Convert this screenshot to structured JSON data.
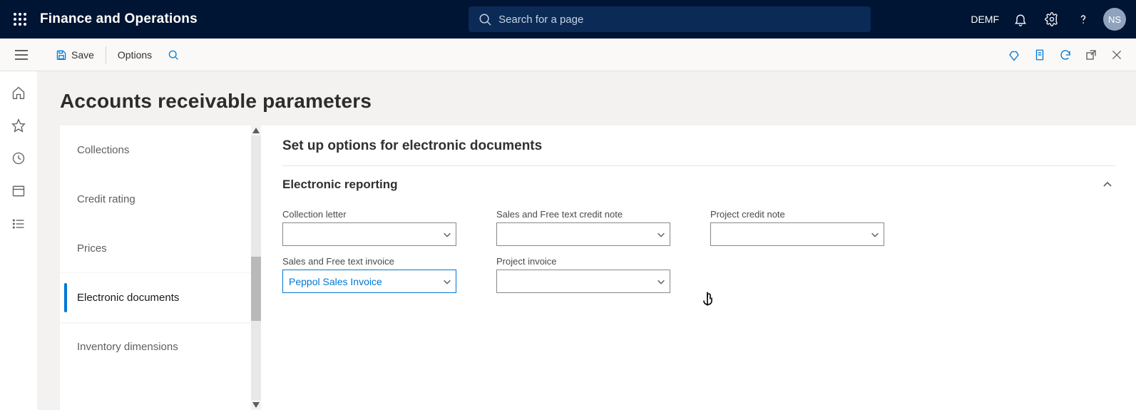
{
  "header": {
    "app_title": "Finance and Operations",
    "search_placeholder": "Search for a page",
    "company": "DEMF",
    "avatar_initials": "NS"
  },
  "actionbar": {
    "save": "Save",
    "options": "Options"
  },
  "page": {
    "title": "Accounts receivable parameters",
    "section_title": "Set up options for electronic documents",
    "group_title": "Electronic reporting"
  },
  "tabs": [
    {
      "label": "Collections",
      "active": false
    },
    {
      "label": "Credit rating",
      "active": false
    },
    {
      "label": "Prices",
      "active": false
    },
    {
      "label": "Electronic documents",
      "active": true
    },
    {
      "label": "Inventory dimensions",
      "active": false
    }
  ],
  "fields": {
    "collection_letter": {
      "label": "Collection letter",
      "value": ""
    },
    "sales_free_credit_note": {
      "label": "Sales and Free text credit note",
      "value": ""
    },
    "project_credit_note": {
      "label": "Project credit note",
      "value": ""
    },
    "sales_free_invoice": {
      "label": "Sales and Free text invoice",
      "value": "Peppol Sales Invoice"
    },
    "project_invoice": {
      "label": "Project invoice",
      "value": ""
    }
  }
}
